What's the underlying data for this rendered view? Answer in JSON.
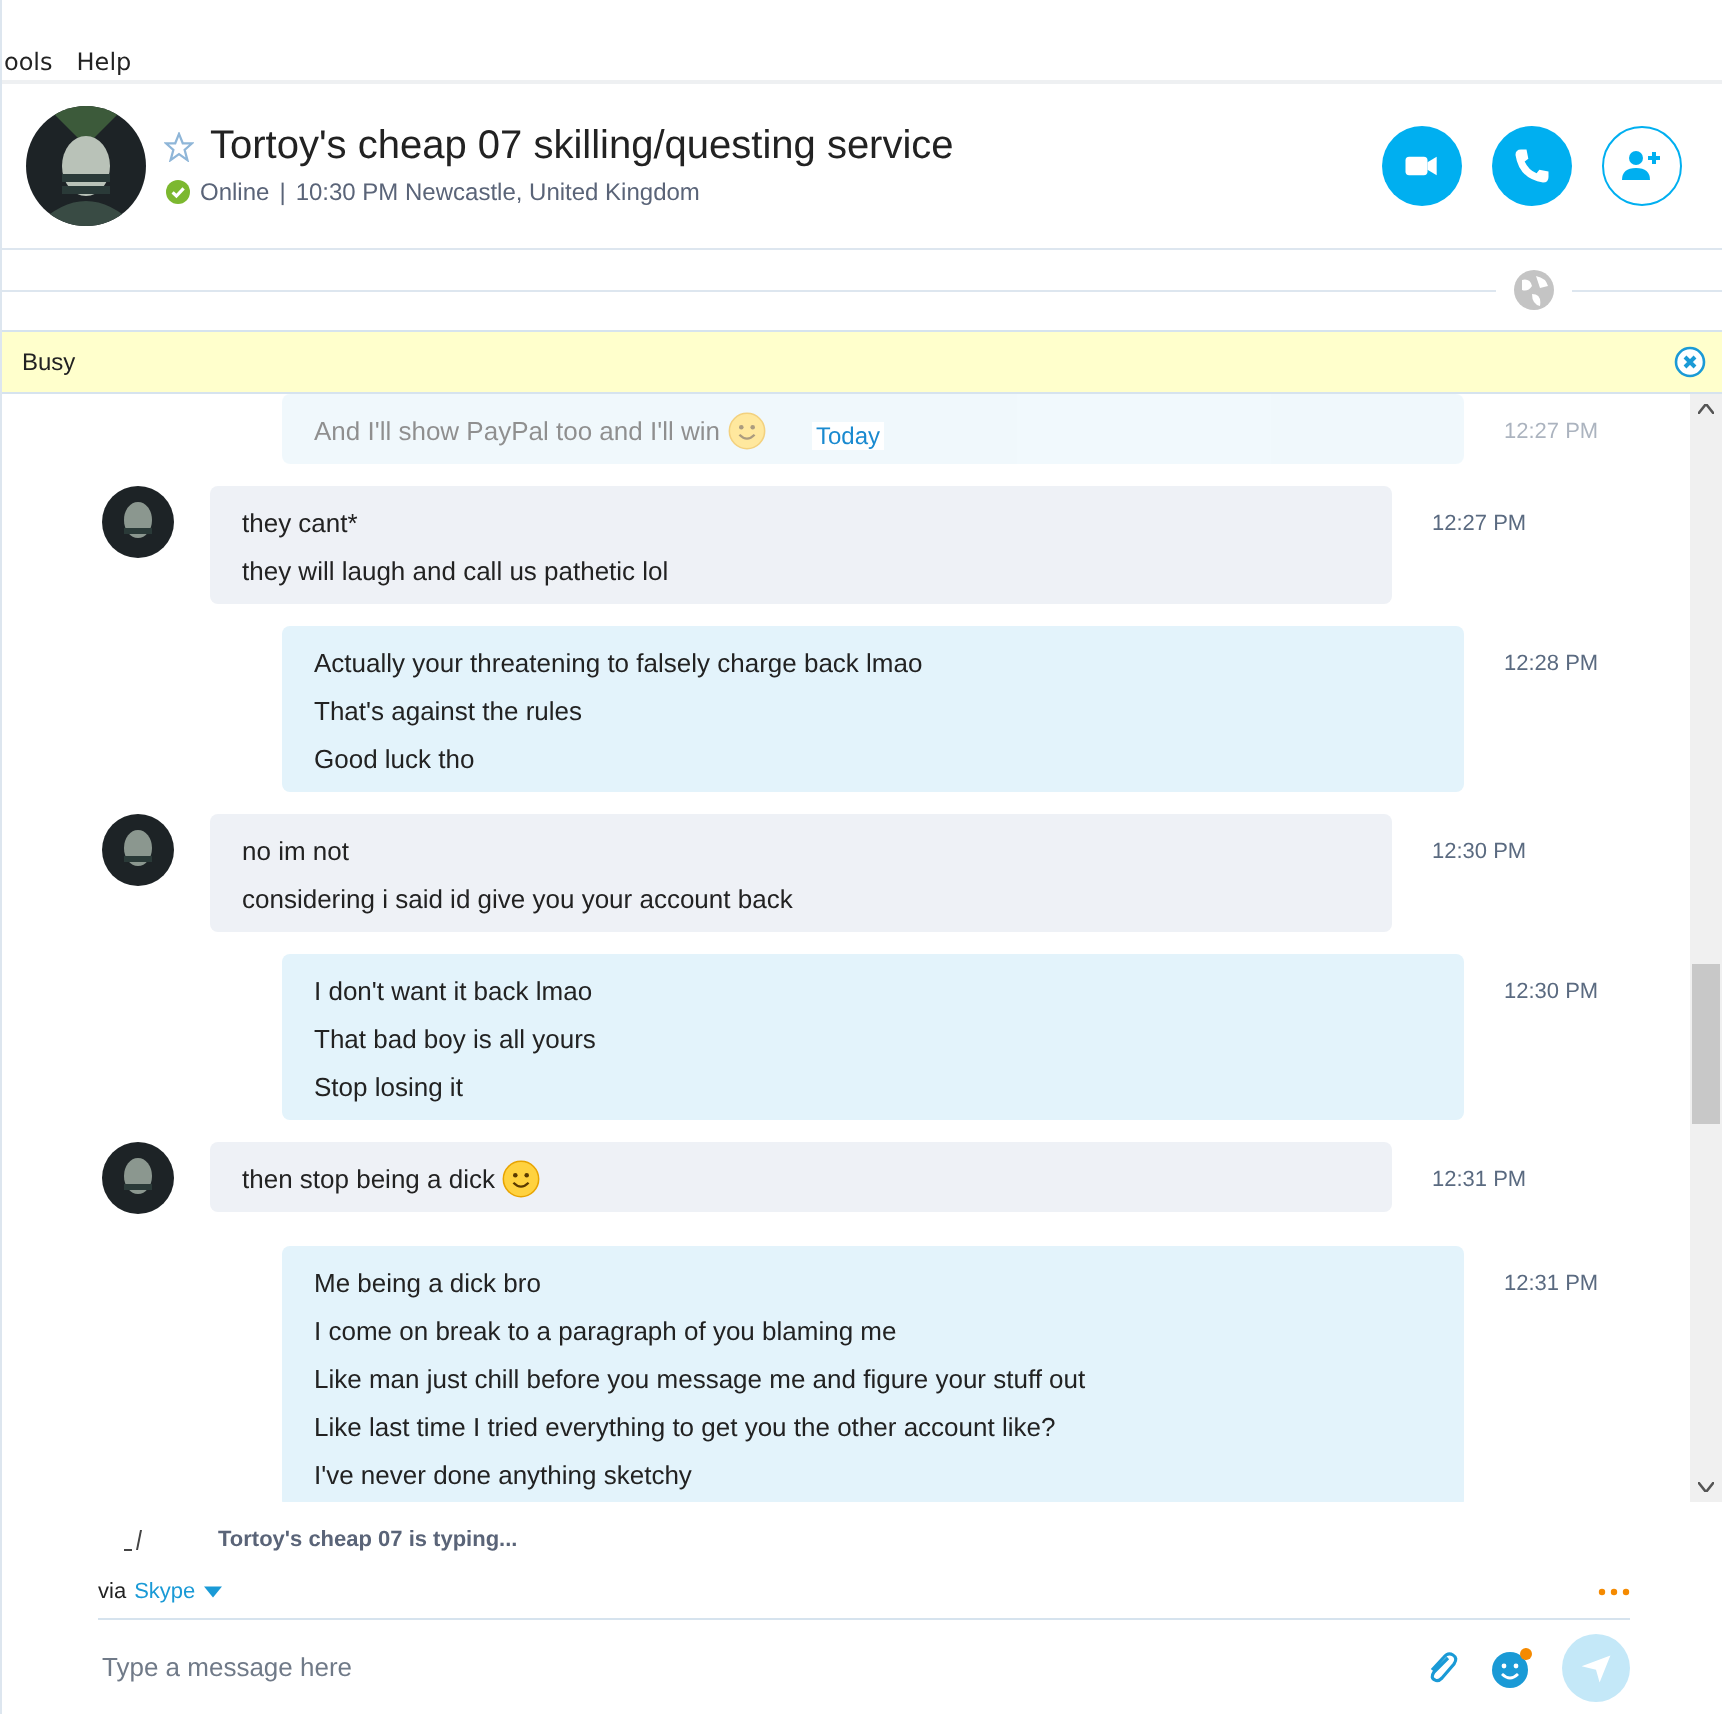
{
  "menu": [
    "ools",
    "Help"
  ],
  "contact": {
    "name": "Tortoy's cheap 07 skilling/questing service",
    "status": "Online",
    "status_online": true,
    "separator": "|",
    "details": "10:30 PM Newcastle, United Kingdom",
    "favorite": false
  },
  "notice": {
    "text": "Busy"
  },
  "date_divider": "Today",
  "messages": [
    {
      "kind": "sent",
      "faded": true,
      "time": "12:27 PM",
      "lines": [
        {
          "text": "And I'll show PayPal too and I'll win",
          "emoji": true
        }
      ]
    },
    {
      "kind": "received",
      "faded": false,
      "time": "12:27 PM",
      "lines": [
        {
          "text": "they cant*",
          "emoji": false
        },
        {
          "text": "they will laugh and call us pathetic lol",
          "emoji": false
        }
      ]
    },
    {
      "kind": "sent",
      "faded": false,
      "time": "12:28 PM",
      "lines": [
        {
          "text": "Actually your threatening to falsely charge back lmao",
          "emoji": false
        },
        {
          "text": "That's against the rules",
          "emoji": false
        },
        {
          "text": "Good luck tho",
          "emoji": false
        }
      ]
    },
    {
      "kind": "received",
      "faded": false,
      "time": "12:30 PM",
      "lines": [
        {
          "text": "no im not",
          "emoji": false
        },
        {
          "text": "considering i said id give you your account back",
          "emoji": false
        }
      ]
    },
    {
      "kind": "sent",
      "faded": false,
      "time": "12:30 PM",
      "lines": [
        {
          "text": "I don't want it back lmao",
          "emoji": false
        },
        {
          "text": "That bad boy is all yours",
          "emoji": false
        },
        {
          "text": "Stop losing it",
          "emoji": false
        }
      ]
    },
    {
      "kind": "received",
      "faded": false,
      "time": "12:31 PM",
      "lines": [
        {
          "text": "then stop being a dick",
          "emoji": true
        }
      ]
    },
    {
      "kind": "sent",
      "faded": false,
      "time": "12:31 PM",
      "lines": [
        {
          "text": "Me being a dick bro",
          "emoji": false
        },
        {
          "text": "I come on break to a paragraph of you blaming me",
          "emoji": false
        },
        {
          "text": "Like man just chill before you message me and figure your stuff out",
          "emoji": false
        },
        {
          "text": "Like last time I tried everything to get you the other account like?",
          "emoji": false
        },
        {
          "text": "I've never done anything sketchy",
          "emoji": false
        }
      ]
    }
  ],
  "typing": {
    "text": "Tortoy's cheap 07 is typing..."
  },
  "via": {
    "prefix": "via",
    "service": "Skype"
  },
  "composer": {
    "placeholder": "Type a message here"
  }
}
